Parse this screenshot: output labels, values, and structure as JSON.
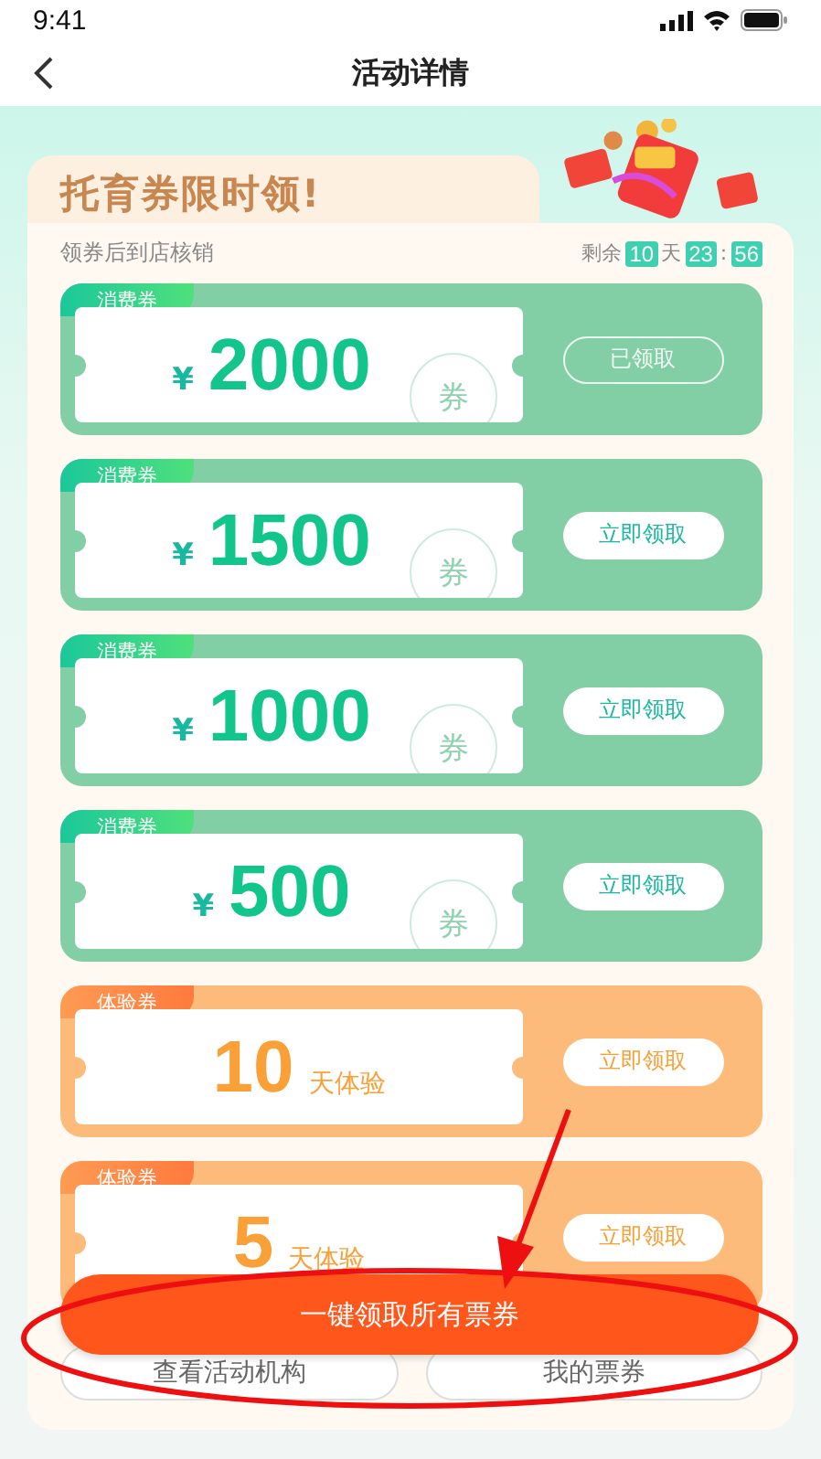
{
  "status_bar": {
    "time": "9:41"
  },
  "nav": {
    "title": "活动详情"
  },
  "promo": {
    "title": "托育券限时领!",
    "subtitle": "领券后到店核销",
    "countdown": {
      "label": "剩余",
      "days": "10",
      "days_unit": "天",
      "hours": "23",
      "separator": ":",
      "minutes": "56"
    }
  },
  "coupons": [
    {
      "kind": "cash",
      "tag": "消费券",
      "currency": "¥",
      "amount": "2000",
      "stamp": "券",
      "claimed": true,
      "button": "已领取"
    },
    {
      "kind": "cash",
      "tag": "消费券",
      "currency": "¥",
      "amount": "1500",
      "stamp": "券",
      "claimed": false,
      "button": "立即领取"
    },
    {
      "kind": "cash",
      "tag": "消费券",
      "currency": "¥",
      "amount": "1000",
      "stamp": "券",
      "claimed": false,
      "button": "立即领取"
    },
    {
      "kind": "cash",
      "tag": "消费券",
      "currency": "¥",
      "amount": "500",
      "stamp": "券",
      "claimed": false,
      "button": "立即领取"
    },
    {
      "kind": "trial",
      "tag": "体验券",
      "amount": "10",
      "unit": "天体验",
      "claimed": false,
      "button": "立即领取"
    },
    {
      "kind": "trial",
      "tag": "体验券",
      "amount": "5",
      "unit": "天体验",
      "claimed": false,
      "button": "立即领取"
    }
  ],
  "claim_all_button": "一键领取所有票券",
  "footer_buttons": [
    "查看活动机构",
    "我的票券"
  ]
}
